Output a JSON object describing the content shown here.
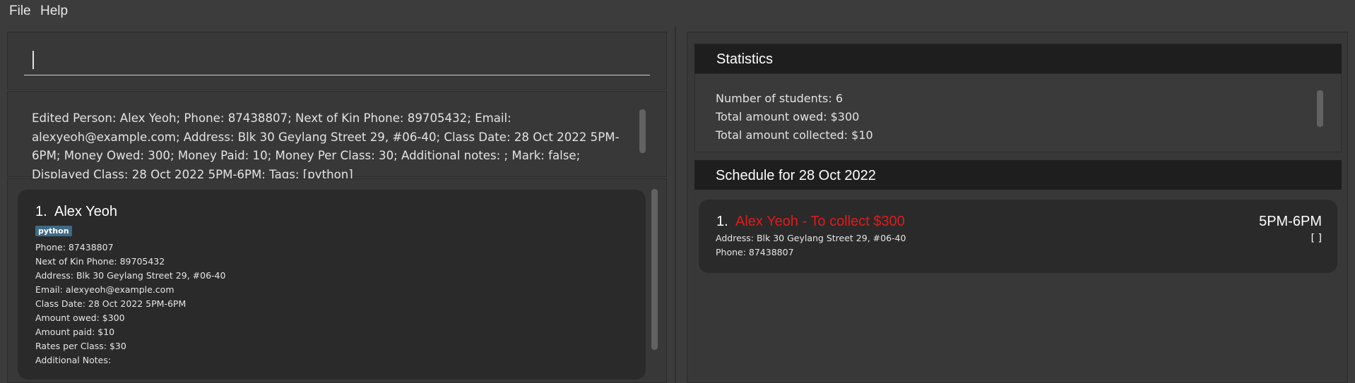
{
  "menu": {
    "file": "File",
    "help": "Help"
  },
  "command": {
    "value": ""
  },
  "result": {
    "text": "Edited Person: Alex Yeoh; Phone: 87438807; Next of Kin Phone: 89705432; Email: alexyeoh@example.com; Address: Blk 30 Geylang Street 29, #06-40; Class Date: 28 Oct 2022 5PM-6PM; Money Owed: 300; Money Paid: 10; Money Per Class: 30; Additional notes: ; Mark: false; Displayed Class: 28 Oct 2022 5PM-6PM; Tags: [python]"
  },
  "person": {
    "index": "1.",
    "name": "Alex Yeoh",
    "tag": "python",
    "phone": "Phone: 87438807",
    "nok_phone": "Next of Kin Phone: 89705432",
    "address": "Address: Blk 30 Geylang Street 29, #06-40",
    "email": "Email: alexyeoh@example.com",
    "class_date": "Class Date: 28 Oct 2022 5PM-6PM",
    "amount_owed": "Amount owed: $300",
    "amount_paid": "Amount paid: $10",
    "rates": "Rates per Class: $30",
    "notes": "Additional Notes:"
  },
  "statistics": {
    "title": "Statistics",
    "num_students": "Number of students: 6",
    "total_owed": "Total amount owed: $300",
    "total_collected": "Total amount collected: $10"
  },
  "schedule": {
    "title": "Schedule for 28 Oct 2022",
    "entry": {
      "index": "1.",
      "name": "Alex Yeoh - To collect $300",
      "time": "5PM-6PM",
      "checkbox": "[ ]",
      "address": "Address: Blk 30 Geylang Street 29, #06-40",
      "phone": "Phone: 87438807"
    }
  },
  "colors": {
    "owed_name": "#e01b1b",
    "tag_bg": "#3e6a86",
    "header_bg": "#1e1e1e",
    "card_bg": "#2a2a2a"
  }
}
